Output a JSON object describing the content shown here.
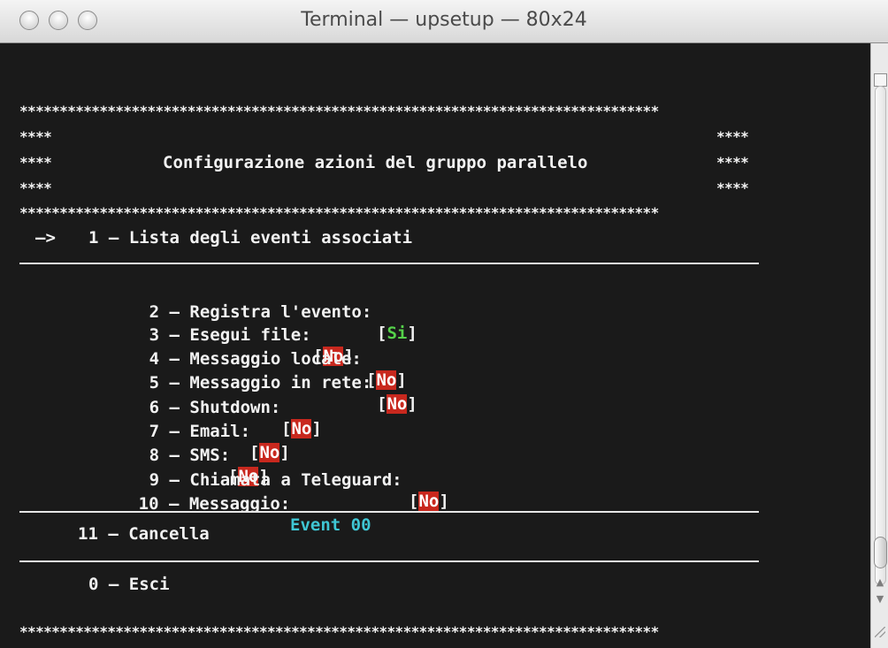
{
  "window": {
    "title": "Terminal — upsetup — 80x24"
  },
  "screen": {
    "stars_full": "********************************************************************************",
    "stars_side": "****",
    "heading": "Configurazione azioni del gruppo parallelo",
    "arrow": "—>",
    "item1": "1 – Lista degli eventi associati",
    "items": [
      {
        "label": "2 – Registra l'evento:",
        "open": "[",
        "value": "Si",
        "close": "]"
      },
      {
        "label": "3 – Esegui file:",
        "open": "[",
        "value": "No",
        "close": "]"
      },
      {
        "label": "4 – Messaggio locale:",
        "open": "[",
        "value": "No",
        "close": "]"
      },
      {
        "label": "5 – Messaggio in rete:",
        "open": "[",
        "value": "No",
        "close": "]"
      },
      {
        "label": "6 – Shutdown:",
        "open": "[",
        "value": "No",
        "close": "]"
      },
      {
        "label": "7 – Email:",
        "open": "[",
        "value": "No",
        "close": "]"
      },
      {
        "label": "8 – SMS:",
        "open": "[",
        "value": "No",
        "close": "]"
      },
      {
        "label": "9 – Chiamata a Teleguard:",
        "open": "[",
        "value": "No",
        "close": "]"
      },
      {
        "label": "10 – Messaggio:",
        "value": "Event 00"
      }
    ],
    "cancel": "11 – Cancella",
    "exit": "0 – Esci"
  },
  "colors": {
    "background": "#1a1a1a",
    "text": "#f2f2f2",
    "yes": "#55d14a",
    "no_bg": "#c8281e",
    "message": "#3fc6d4"
  }
}
